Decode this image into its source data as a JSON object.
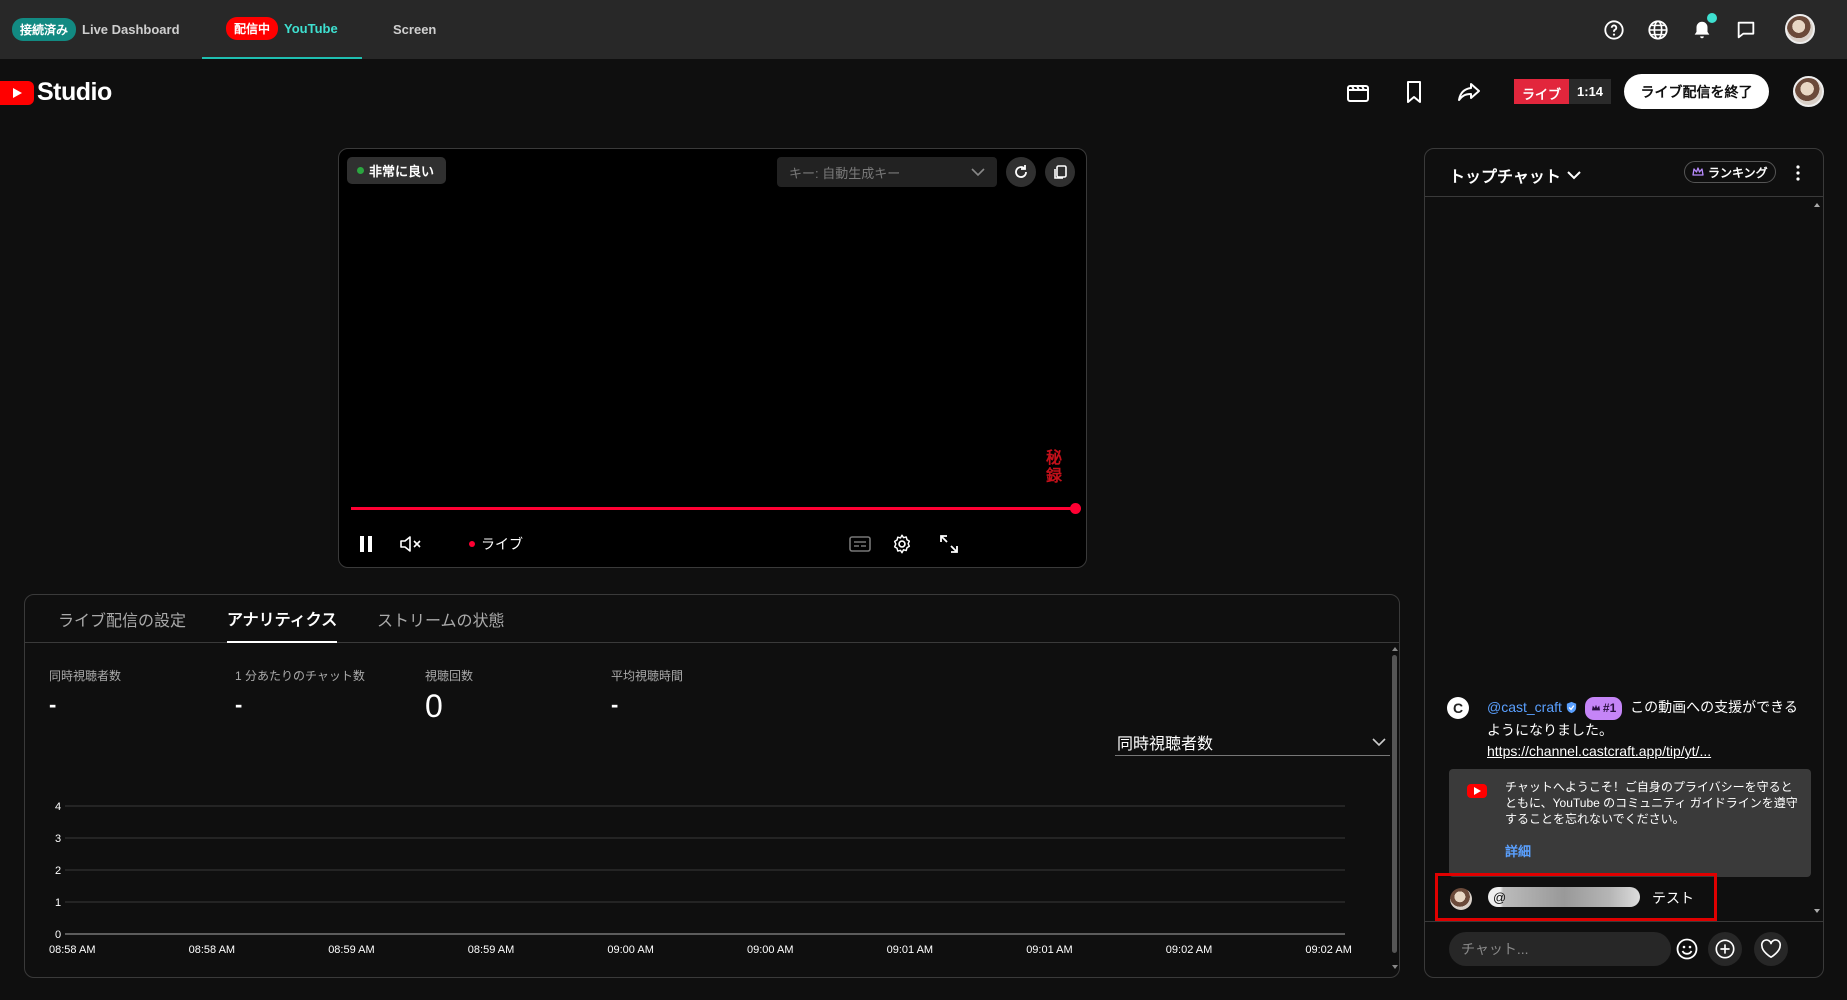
{
  "topbar": {
    "tabs": [
      {
        "badge": "接続済み",
        "label": "Live Dashboard"
      },
      {
        "badge": "配信中",
        "label": "YouTube"
      },
      {
        "label": "Screen"
      }
    ],
    "icons": [
      "help-icon",
      "globe-icon",
      "bell-icon",
      "chat-bubble-icon",
      "avatar"
    ]
  },
  "studio": {
    "logo_text": "Studio",
    "live_label": "ライブ",
    "live_time": "1:14",
    "end_button": "ライブ配信を終了"
  },
  "player": {
    "quality": "非常に良い",
    "key_placeholder": "キー: 自動生成キー",
    "live_label": "ライブ",
    "watermark": "秘録",
    "progress": 1.0
  },
  "analytics": {
    "tabs": [
      "ライブ配信の設定",
      "アナリティクス",
      "ストリームの状態"
    ],
    "active_tab": 1,
    "metrics": [
      {
        "label": "同時視聴者数",
        "value": "-"
      },
      {
        "label": "1 分あたりのチャット数",
        "value": "-"
      },
      {
        "label": "視聴回数",
        "value": "0"
      },
      {
        "label": "平均視聴時間",
        "value": "-"
      }
    ],
    "metric_select": "同時視聴者数"
  },
  "chart_data": {
    "type": "line",
    "x": [
      "08:58 AM",
      "08:58 AM",
      "08:59 AM",
      "08:59 AM",
      "09:00 AM",
      "09:00 AM",
      "09:01 AM",
      "09:01 AM",
      "09:02 AM",
      "09:02 AM"
    ],
    "y_ticks": [
      0,
      1,
      2,
      3,
      4
    ],
    "ylim": [
      0,
      4
    ],
    "series": [
      {
        "values": [
          0,
          0,
          0,
          0,
          0,
          0,
          0,
          0,
          0,
          0
        ]
      }
    ],
    "grid": true
  },
  "chat": {
    "title": "トップチャット",
    "ranking": "ランキング",
    "msg1": {
      "author": "@cast_craft",
      "rank": "#1",
      "text": "この動画への支援ができるようになりました。",
      "link": "https://channel.castcraft.app/tip/yt/..."
    },
    "welcome": {
      "text": "チャットへようこそ！ご自身のプライバシーを守るとともに、YouTube のコミュニティ ガイドラインを遵守することを忘れないでください。",
      "link": "詳細"
    },
    "msg2": {
      "mention": "@",
      "text": "テスト"
    },
    "input_placeholder": "チャット..."
  },
  "colors": {
    "accent_teal": "#1fbfb1",
    "live_red": "#ff0033",
    "author_blue": "#5aa0ff",
    "highlight_border": "#e00000"
  }
}
